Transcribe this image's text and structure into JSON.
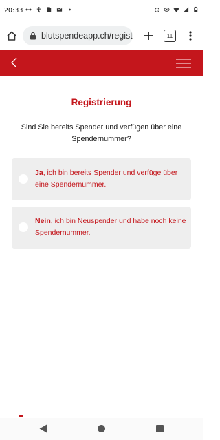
{
  "status_bar": {
    "time": "20:33",
    "left_icons": [
      "link-icon",
      "accessibility-icon",
      "sim-icon",
      "mail-icon",
      "dot-icon"
    ],
    "right_icons": [
      "alarm-icon",
      "eye-icon",
      "wifi-icon",
      "signal-icon",
      "battery-icon"
    ]
  },
  "browser": {
    "url": "blutspendeapp.ch/registrie",
    "tab_count": "11"
  },
  "app_header": {
    "accent_color": "#c4161c"
  },
  "page": {
    "title": "Registrierung",
    "question": "Sind Sie bereits Spender und verfügen über eine Spendernummer?",
    "options": [
      {
        "bold": "Ja",
        "text": ", ich bin bereits Spender und verfüge über eine Spendernummer."
      },
      {
        "bold": "Nein",
        "text": ", ich bin Neuspender und habe noch keine Spendernummer."
      }
    ]
  },
  "nav_bar": {
    "buttons": [
      "back-icon",
      "home-icon",
      "recents-icon"
    ]
  }
}
